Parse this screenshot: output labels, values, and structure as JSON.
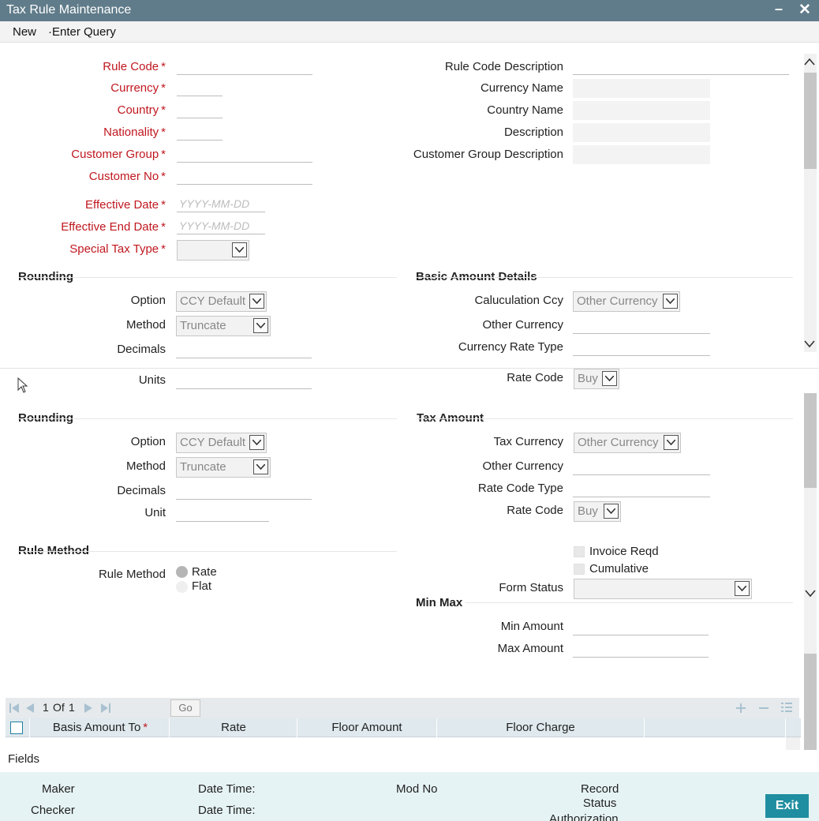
{
  "window": {
    "title": "Tax Rule Maintenance",
    "minimize": "–",
    "close": "✕"
  },
  "menu": {
    "new": "New",
    "enter_query": "·Enter Query"
  },
  "form": {
    "rule_code": {
      "label": "Rule Code",
      "value": ""
    },
    "currency": {
      "label": "Currency",
      "value": ""
    },
    "country": {
      "label": "Country",
      "value": ""
    },
    "nationality": {
      "label": "Nationality",
      "value": ""
    },
    "customer_group": {
      "label": "Customer Group",
      "value": ""
    },
    "customer_no": {
      "label": "Customer No",
      "value": ""
    },
    "effective_date": {
      "label": "Effective Date",
      "placeholder": "YYYY-MM-DD"
    },
    "effective_end_date": {
      "label": "Effective End Date",
      "placeholder": "YYYY-MM-DD"
    },
    "special_tax_type": {
      "label": "Special Tax Type",
      "value": ""
    },
    "rule_code_description": {
      "label": "Rule Code Description",
      "value": ""
    },
    "currency_name": {
      "label": "Currency Name",
      "value": ""
    },
    "country_name": {
      "label": "Country Name",
      "value": ""
    },
    "description": {
      "label": "Description",
      "value": ""
    },
    "customer_group_description": {
      "label": "Customer Group Description",
      "value": ""
    },
    "required_mark": "*"
  },
  "rounding1": {
    "title": "Rounding",
    "option_label": "Option",
    "option_value": "CCY Default",
    "method_label": "Method",
    "method_value": "Truncate",
    "decimals_label": "Decimals",
    "units_label": "Units"
  },
  "basic_amount": {
    "title": "Basic Amount Details",
    "calc_ccy_label": "Caluculation Ccy",
    "calc_ccy_value": "Other Currency",
    "other_currency_label": "Other Currency",
    "currency_rate_type_label": "Currency Rate Type",
    "rate_code_label": "Rate Code",
    "rate_code_value": "Buy"
  },
  "rounding2": {
    "title": "Rounding",
    "option_label": "Option",
    "option_value": "CCY Default",
    "method_label": "Method",
    "method_value": "Truncate",
    "decimals_label": "Decimals",
    "unit_label": "Unit"
  },
  "tax_amount": {
    "title": "Tax Amount",
    "tax_currency_label": "Tax Currency",
    "tax_currency_value": "Other Currency",
    "other_currency_label": "Other Currency",
    "rate_code_type_label": "Rate Code Type",
    "rate_code_label": "Rate Code",
    "rate_code_value": "Buy"
  },
  "rule_method": {
    "title": "Rule Method",
    "label": "Rule Method",
    "options": [
      "Rate",
      "Flat"
    ]
  },
  "flags": {
    "invoice_reqd": "Invoice Reqd",
    "cumulative": "Cumulative",
    "form_status_label": "Form Status"
  },
  "min_max": {
    "title": "Min Max",
    "min_label": "Min Amount",
    "max_label": "Max Amount"
  },
  "grid": {
    "pager": {
      "page": "1",
      "of": "Of",
      "total": "1",
      "go": "Go"
    },
    "columns": [
      "Basis Amount To",
      "Rate",
      "Floor Amount",
      "Floor Charge"
    ],
    "required_mark": "*"
  },
  "fields_link": "Fields",
  "audit": {
    "maker": "Maker",
    "checker": "Checker",
    "date_time_1": "Date Time:",
    "date_time_2": "Date Time:",
    "mod_no": "Mod No",
    "record_status": "Record\nStatus",
    "authorization": "Authorization",
    "exit": "Exit"
  },
  "colors": {
    "titlebar": "#607c8a",
    "required": "#c0171f",
    "footer": "#e6f3f4",
    "exit": "#1f8ea0"
  }
}
